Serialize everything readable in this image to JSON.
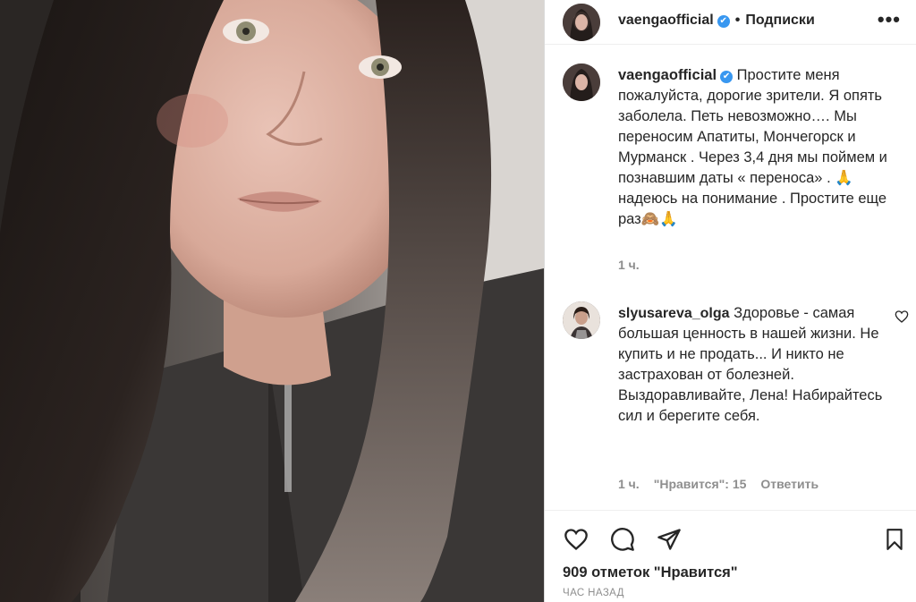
{
  "post": {
    "author": "vaengaofficial",
    "verified_glyph": "✔",
    "dot": "•",
    "follow_label": "Подписки",
    "more_label": "•••",
    "caption_text": "Простите меня пожалуйста, дорогие зрители. Я опять заболела. Петь невозможно…. Мы переносим Апатиты, Мончегорск и Мурманск . Через 3,4 дня мы поймем и познавшим даты « переноса» . 🙏 надеюсь на понимание . Простите еще раз🙈🙏",
    "caption_time": "1 ч."
  },
  "comment": {
    "author": "slyusareva_olga",
    "text": "Здоровье - самая большая ценность в нашей жизни. Не купить и не продать... И никто не застрахован от болезней. Выздоравливайте, Лена! Набирайтесь сил и берегите себя.",
    "time": "1 ч.",
    "likes_label": "\"Нравится\": 15",
    "reply_label": "Ответить"
  },
  "footer": {
    "likes_text": "909 отметок \"Нравится\"",
    "posted_ago": "ЧАС НАЗАД"
  },
  "icons": {
    "like": "heart-icon",
    "comment": "comment-icon",
    "share": "paper-plane-icon",
    "save": "bookmark-icon"
  },
  "colors": {
    "verified": "#3897f0",
    "muted": "#8e8e8e",
    "text": "#262626"
  }
}
